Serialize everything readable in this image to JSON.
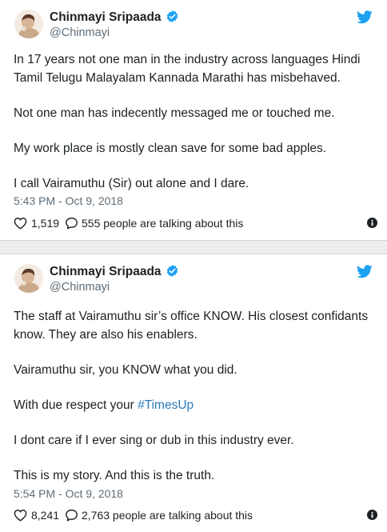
{
  "tweets": [
    {
      "author_name": "Chinmayi Sripaada",
      "handle": "@Chinmayi",
      "paragraphs": [
        "In 17 years not one man in the industry across languages Hindi Tamil Telugu Malayalam Kannada Marathi has misbehaved.",
        "Not one man has indecently messaged me or touched me.",
        "My work place is mostly clean save for some bad apples.",
        "I call Vairamuthu (Sir) out alone and I dare."
      ],
      "timestamp": "5:43 PM - Oct 9, 2018",
      "likes": "1,519",
      "talking": "555 people are talking about this"
    },
    {
      "author_name": "Chinmayi Sripaada",
      "handle": "@Chinmayi",
      "paragraphs": [
        "The staff at Vairamuthu sir’s office KNOW. His closest confidants know. They are also his enablers.",
        "Vairamuthu sir, you KNOW what you did.",
        "With due respect your",
        "I dont care if I ever sing or dub in this industry ever.",
        "This is my story. And this is the truth."
      ],
      "hashtag": "#TimesUp",
      "timestamp": "5:54 PM - Oct 9, 2018",
      "likes": "8,241",
      "talking": "2,763 people are talking about this"
    }
  ],
  "colors": {
    "text": "#1c2022",
    "secondary": "#5e6c77",
    "link": "#2b7bb9",
    "verified": "#1da1f2",
    "twitter_blue": "#1da1f2",
    "separator": "#ededed"
  }
}
